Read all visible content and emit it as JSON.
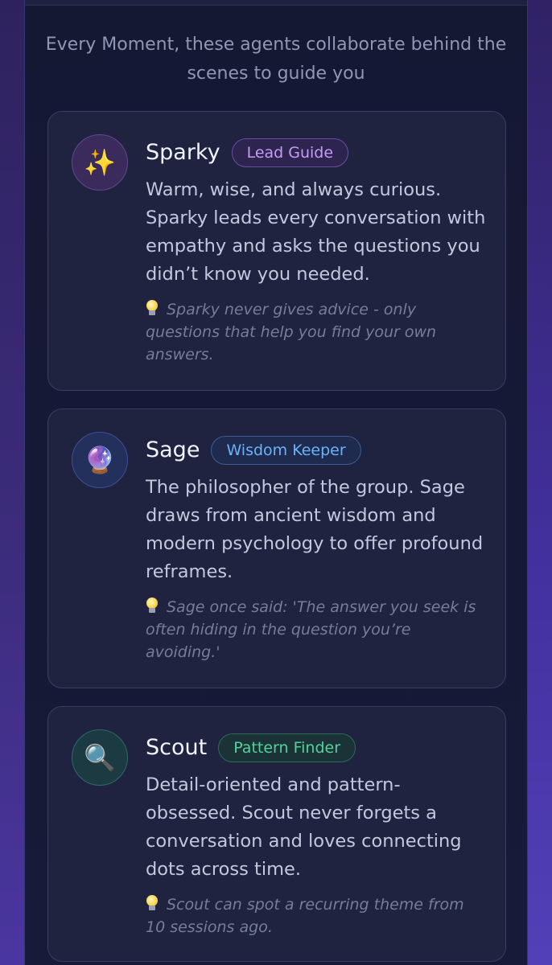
{
  "intro": "Every Moment, these agents collaborate behind the scenes to guide you",
  "agents": [
    {
      "name": "Sparky",
      "badge": "Lead Guide",
      "icon": "sparkles-icon",
      "icon_glyph": "✨",
      "description": "Warm, wise, and always curious. Sparky leads every conversation with empathy and asks the questions you didn’t know you needed.",
      "tip": "Sparky never gives advice - only questions that help you find your own answers.",
      "accent": "#c79bf5"
    },
    {
      "name": "Sage",
      "badge": "Wisdom Keeper",
      "icon": "crystal-ball-icon",
      "icon_glyph": "🔮",
      "description": "The philosopher of the group. Sage draws from ancient wisdom and modern psychology to offer profound reframes.",
      "tip": "Sage once said: 'The answer you seek is often hiding in the question you’re avoiding.'",
      "accent": "#6cb2f7"
    },
    {
      "name": "Scout",
      "badge": "Pattern Finder",
      "icon": "magnifying-glass-icon",
      "icon_glyph": "🔍",
      "description": "Detail-oriented and pattern-obsessed. Scout never forgets a conversation and loves connecting dots across time.",
      "tip": "Scout can spot a recurring theme from 10 sessions ago.",
      "accent": "#4fd49a"
    }
  ]
}
